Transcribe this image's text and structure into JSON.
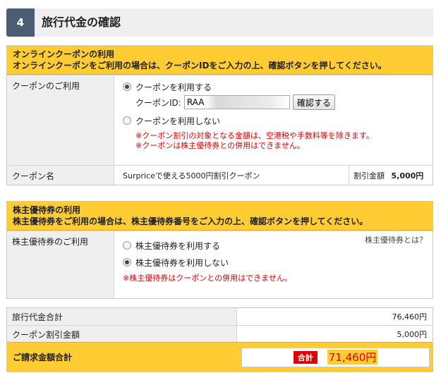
{
  "step": {
    "number": "4",
    "title": "旅行代金の確認"
  },
  "coupon_section": {
    "head_line1": "オンラインクーポンの利用",
    "head_line2": "オンラインクーポンをご利用の場合は、クーポンIDをご入力の上、確認ボタンを押してください。",
    "usage_label": "クーポンのご利用",
    "option_use": "クーポンを利用する",
    "coupon_id_label": "クーポンID:",
    "coupon_id_value": "RAA",
    "confirm_button": "確認する",
    "option_not_use": "クーポンを利用しない",
    "note1": "※クーポン割引の対象となる金額は、空港税や手数料等を除きます。",
    "note2": "※クーポンは株主優待券との併用はできません。",
    "name_label": "クーポン名",
    "name_value": "Surpriceで使える5000円割引クーポン",
    "discount_label": "割引金額",
    "discount_value": "5,000円"
  },
  "shareholder_section": {
    "head_line1": "株主優待券の利用",
    "head_line2": "株主優待券をご利用の場合は、株主優待券番号をご入力の上、確認ボタンを押してください。",
    "usage_label": "株主優待券のご利用",
    "help_link": "株主優待券とは？",
    "option_use": "株主優待券を利用する",
    "option_not_use": "株主優待券を利用しない",
    "note": "※株主優待券はクーポンとの併用はできません。"
  },
  "summary": {
    "travel_total_label": "旅行代金合計",
    "travel_total_value": "76,460円",
    "coupon_discount_label": "クーポン割引金額",
    "coupon_discount_value": "5,000円",
    "grand_total_label": "ご請求金額合計",
    "grand_total_badge": "合計",
    "grand_total_value": "71,460円"
  }
}
